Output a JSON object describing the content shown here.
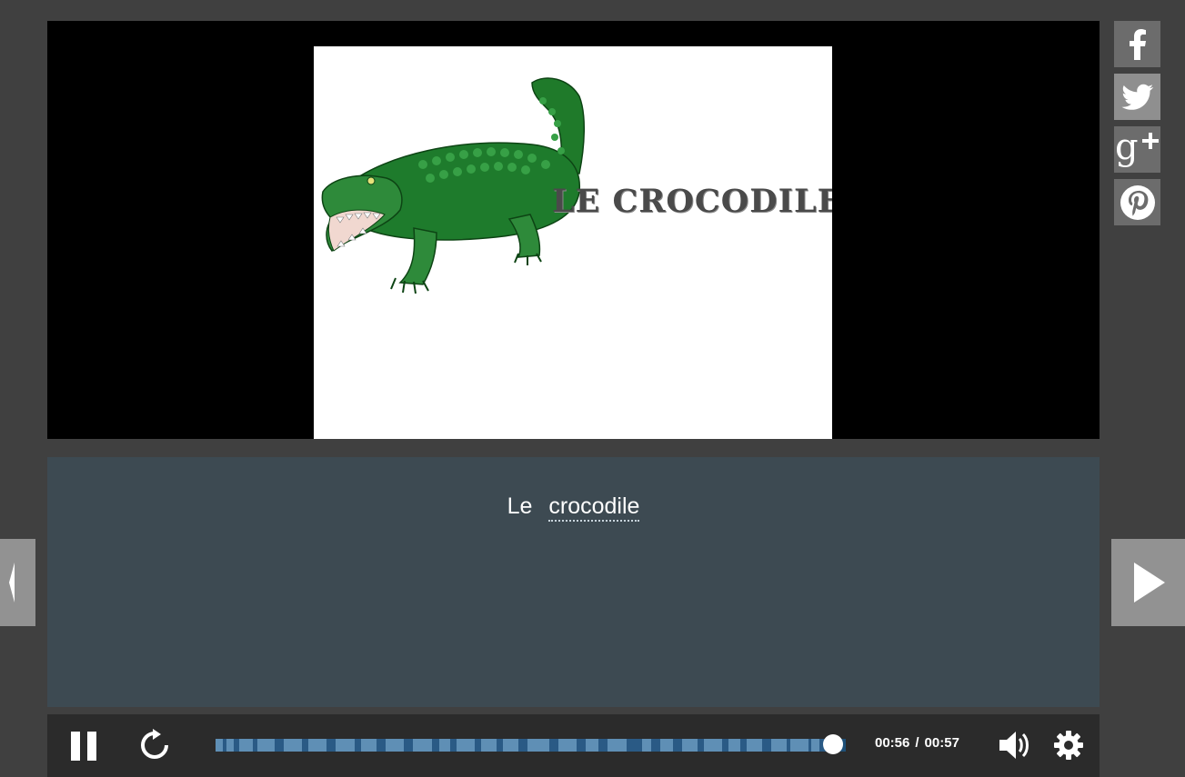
{
  "slide": {
    "title": "LE CROCODILE"
  },
  "share": [
    {
      "name": "facebook-icon"
    },
    {
      "name": "twitter-icon"
    },
    {
      "name": "google-plus-icon"
    },
    {
      "name": "pinterest-icon"
    }
  ],
  "transcript": {
    "words": [
      "Le",
      "crocodile"
    ]
  },
  "player": {
    "current_time": "00:56",
    "separator": "/",
    "duration": "00:57",
    "progress_fraction": 0.98,
    "accent": "#1e5078"
  },
  "icons": {
    "pause": "pause-icon",
    "replay": "replay-icon",
    "volume": "volume-icon",
    "settings": "gear-icon",
    "prev": "chevron-left-icon",
    "next": "chevron-right-icon"
  }
}
